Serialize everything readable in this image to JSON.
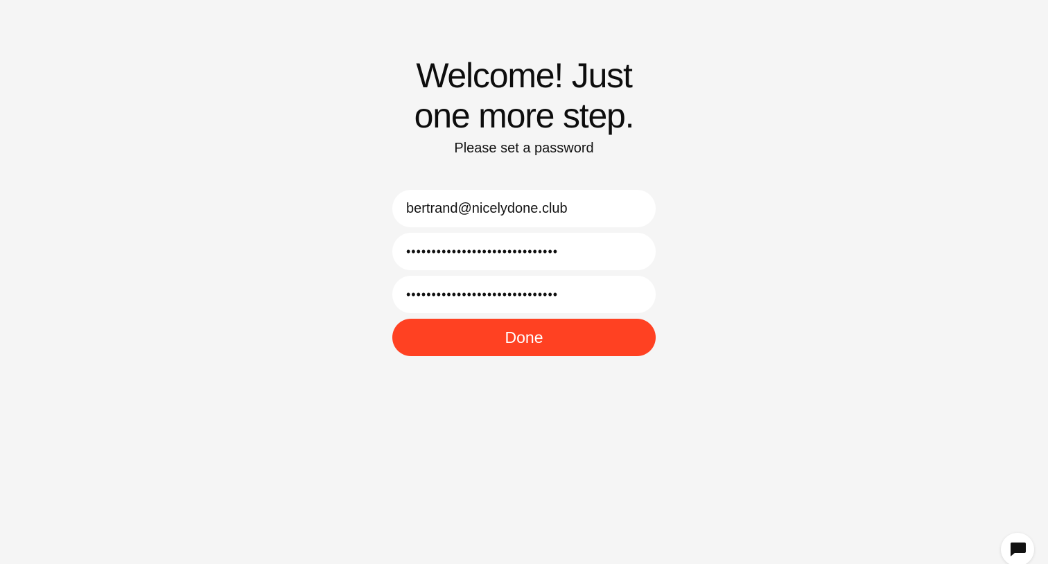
{
  "heading": {
    "line1": "Welcome! Just",
    "line2": "one more step."
  },
  "subtitle": "Please set a password",
  "form": {
    "email_value": "bertrand@nicelydone.club",
    "password_value": "••••••••••••••••••••••••••••••",
    "confirm_password_value": "••••••••••••••••••••••••••••••",
    "done_label": "Done"
  },
  "chat_widget": {
    "icon": "chat-bubble-icon"
  },
  "colors": {
    "background": "#f5f5f5",
    "accent": "#ff4122",
    "field_background": "#ffffff",
    "text": "#111111"
  }
}
